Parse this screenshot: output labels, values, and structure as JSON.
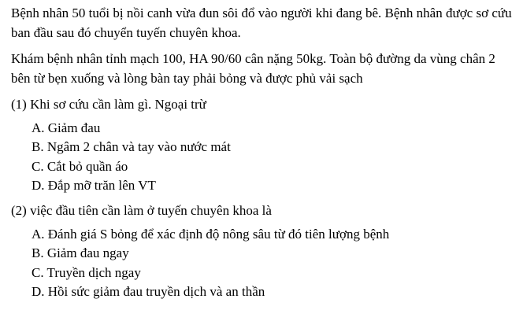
{
  "case": {
    "paragraph_1": "Bệnh nhân 50 tuổi bị nồi canh vừa đun sôi đổ vào người khi đang bê. Bệnh nhân được sơ cứu ban đầu sau đó chuyển tuyến chuyên khoa.",
    "paragraph_2": "Khám bệnh nhân tỉnh mạch 100, HA 90/60 cân nặng 50kg. Toàn bộ đường da vùng chân 2 bên từ bẹn xuống và lòng bàn tay phải bỏng và được phủ vải sạch"
  },
  "questions": [
    {
      "prompt": "(1) Khi sơ cứu cần làm gì. Ngoại trừ",
      "options": [
        "A. Giảm đau",
        "B. Ngâm 2 chân và tay vào nước mát",
        "C. Cắt bỏ quần áo",
        "D. Đắp mỡ trăn lên VT"
      ]
    },
    {
      "prompt": "(2) việc đầu tiên cần làm ở tuyến chuyên khoa là",
      "options": [
        "A. Đánh giá S bỏng để xác định độ nông sâu từ đó tiên lượng bệnh",
        "B. Giảm đau ngay",
        "C. Truyền dịch ngay",
        "D. Hồi sức giảm đau truyền dịch và an thần"
      ]
    }
  ]
}
